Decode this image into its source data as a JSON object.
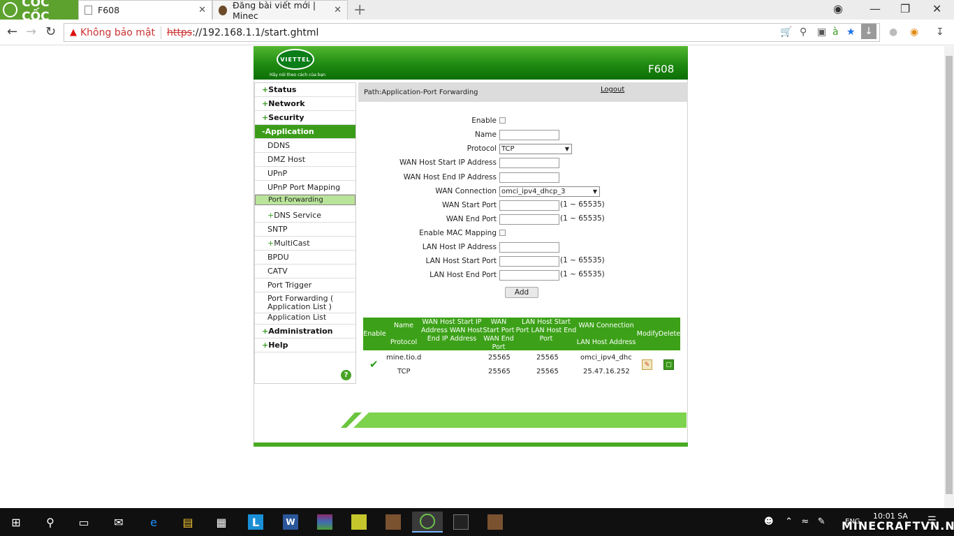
{
  "browser": {
    "brand": "CỐC CỐC",
    "tabs": [
      {
        "title": "F608",
        "close": "✕"
      },
      {
        "title": "Đăng bài viết mới | Minec",
        "close": "✕"
      }
    ],
    "new_tab": "+",
    "security_label": "Không bảo mật",
    "url_scheme": "https",
    "url_rest": "://192.168.1.1/start.ghtml"
  },
  "router": {
    "slogan": "Hãy nói theo cách của bạn",
    "logo_text": "VIETTEL",
    "model": "F608",
    "path": "Path:Application-Port Forwarding",
    "logout": "Logout",
    "menu": [
      {
        "label": "Status",
        "prefix": "+"
      },
      {
        "label": "Network",
        "prefix": "+"
      },
      {
        "label": "Security",
        "prefix": "+"
      },
      {
        "label": "Application",
        "prefix": "-"
      }
    ],
    "submenu": [
      {
        "label": "DDNS",
        "prefix": ""
      },
      {
        "label": "DMZ Host",
        "prefix": ""
      },
      {
        "label": "UPnP",
        "prefix": ""
      },
      {
        "label": "UPnP Port Mapping",
        "prefix": ""
      },
      {
        "label": "Port Forwarding",
        "prefix": ""
      },
      {
        "label": "DNS Service",
        "prefix": "+"
      },
      {
        "label": "SNTP",
        "prefix": ""
      },
      {
        "label": "MultiCast",
        "prefix": "+"
      },
      {
        "label": "BPDU",
        "prefix": ""
      },
      {
        "label": "CATV",
        "prefix": ""
      },
      {
        "label": "Port Trigger",
        "prefix": ""
      },
      {
        "label": "Port Forwarding ( Application List )",
        "prefix": ""
      },
      {
        "label": "Application List",
        "prefix": ""
      }
    ],
    "menu_bottom": [
      {
        "label": "Administration",
        "prefix": "+"
      },
      {
        "label": "Help",
        "prefix": "+"
      }
    ],
    "help_icon": "?",
    "form": {
      "enable": "Enable",
      "name": "Name",
      "protocol": "Protocol",
      "protocol_value": "TCP",
      "wan_start_ip": "WAN Host Start IP Address",
      "wan_end_ip": "WAN Host End IP Address",
      "wan_connection": "WAN Connection",
      "wan_connection_value": "omci_ipv4_dhcp_3",
      "wan_start_port": "WAN Start Port",
      "wan_end_port": "WAN End Port",
      "enable_mac": "Enable MAC Mapping",
      "lan_host_ip": "LAN Host IP Address",
      "lan_start_port": "LAN Host Start Port",
      "lan_end_port": "LAN Host End Port",
      "range": "(1 ~ 65535)",
      "add": "Add"
    },
    "table": {
      "headers": {
        "enable": "Enable",
        "name": "Name",
        "protocol": "Protocol",
        "wan_ip": "WAN Host Start IP Address WAN Host End IP Address",
        "wan_port": "WAN Start Port WAN End Port",
        "lan_port": "LAN Host Start Port LAN Host End Port",
        "wan_conn": "WAN Connection",
        "lan_ip": "LAN Host Address",
        "modify": "Modify",
        "delete": "Delete"
      },
      "row": {
        "name": "mine.tio.d",
        "protocol": "TCP",
        "wan_start_port": "25565",
        "wan_end_port": "25565",
        "lan_start_port": "25565",
        "lan_end_port": "25565",
        "wan_conn": "omci_ipv4_dhc",
        "lan_ip": "25.47.16.252"
      }
    }
  },
  "taskbar": {
    "time": "10:01 SA",
    "lang": "ENG",
    "watermark": "MINECRAFTVN.NET"
  },
  "colors": {
    "brand_green": "#3ca118",
    "header_green": "#1f8a12",
    "selected_menu": "#b9e49a"
  }
}
